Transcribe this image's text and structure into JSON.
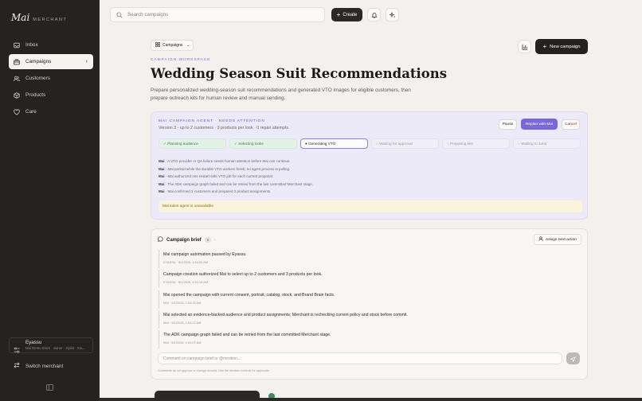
{
  "brand": {
    "name": "Mai",
    "subtitle": "MERCHANT"
  },
  "sidebar": {
    "items": [
      {
        "label": "Inbox",
        "icon": "inbox-icon"
      },
      {
        "label": "Campaigns",
        "icon": "campaigns-icon",
        "active": true
      },
      {
        "label": "Customers",
        "icon": "customers-icon"
      },
      {
        "label": "Products",
        "icon": "products-icon"
      },
      {
        "label": "Care",
        "icon": "care-icon"
      }
    ],
    "user": {
      "name": "Eyassu",
      "meta": "Mai Demo Store · owner · stylist · ma..."
    },
    "switch_label": "Switch merchant"
  },
  "topbar": {
    "search_placeholder": "Search campaigns",
    "create_label": "Create"
  },
  "page": {
    "campaigns_dropdown": "Campaigns",
    "new_campaign_label": "New campaign",
    "eyebrow": "CAMPAIGN WORKSPACE",
    "title": "Wedding Season Suit Recommendations",
    "description": "Prepare personalized wedding-season suit recommendations and generated VTO images for eligible customers, then prepare outreach kits for human review and manual sending."
  },
  "agent": {
    "label": "MAI CAMPAIGN AGENT · NEEDS ATTENTION",
    "subtitle": "Version 3 · up to 2 customers · 3 products per look · 0 repair attempts",
    "pause_label": "Pause",
    "replan_label": "Replan with Mai",
    "cancel_label": "Cancel",
    "steps": [
      {
        "label": "✓ Planning audience",
        "state": "done"
      },
      {
        "label": "✓ Selecting looks",
        "state": "done"
      },
      {
        "label": "● Generating VTO",
        "state": "current"
      },
      {
        "label": "○ Waiting for approval",
        "state": "pending"
      },
      {
        "label": "○ Preparing kits",
        "state": "pending"
      },
      {
        "label": "○ Waiting to send",
        "state": "pending"
      }
    ],
    "log": [
      {
        "who": "Mai",
        "text": " · A VTO provider or QA failure needs human attention before Mai can continue."
      },
      {
        "who": "Mai",
        "text": " · Mai parked while the durable VTO workers finish; no agent process is polling."
      },
      {
        "who": "Mai",
        "text": " · Mai authorized one restart-safe VTO job for each current proposal."
      },
      {
        "who": "Mai",
        "text": " · The ADK campaign graph failed and can be retried from the last committed Merchant stage."
      },
      {
        "who": "Mai",
        "text": " · Mai confirmed 2 customers and prepared 2 product assignments."
      }
    ],
    "warning": "Mai sales agent is unavailable"
  },
  "brief": {
    "title": "Campaign brief",
    "count": "8",
    "assign_label": "Assign next action",
    "entries": [
      {
        "text": "Mai campaign automation paused by Eyassu.",
        "meta": "EYASSU · 5/1/2026, 1:54:55 AM"
      },
      {
        "text": "Campaign creation authorized Mai to select up to 2 customers and 3 products per look.",
        "meta": "EYASSU · 5/1/2026, 1:54:16 AM"
      },
      {
        "text": "Mai opened the campaign with current consent, portrait, catalog, stock, and Brand Brain facts.",
        "meta": "MAI · 5/1/2026, 1:54:20 AM"
      },
      {
        "text": "Mai selected an evidence-backed audience and product assignments; Merchant is rechecking current policy and stock before commit.",
        "meta": "MAI · 5/1/2026, 1:54:27 AM"
      },
      {
        "text": "The ADK campaign graph failed and can be retried from the last committed Merchant stage.",
        "meta": "MAI · 5/1/2026, 1:54:27 AM"
      }
    ],
    "comment_placeholder": "Comment on campaign brief or @mention...",
    "hint": "Comments do not approve or change records. Use the decision controls for approvals."
  },
  "colors": {
    "accent": "#7a68d8",
    "sidebar_bg": "#242322",
    "main_bg": "#f3f1ed",
    "agent_bg": "#ece9f8",
    "warning_bg": "#fbf3dc"
  }
}
